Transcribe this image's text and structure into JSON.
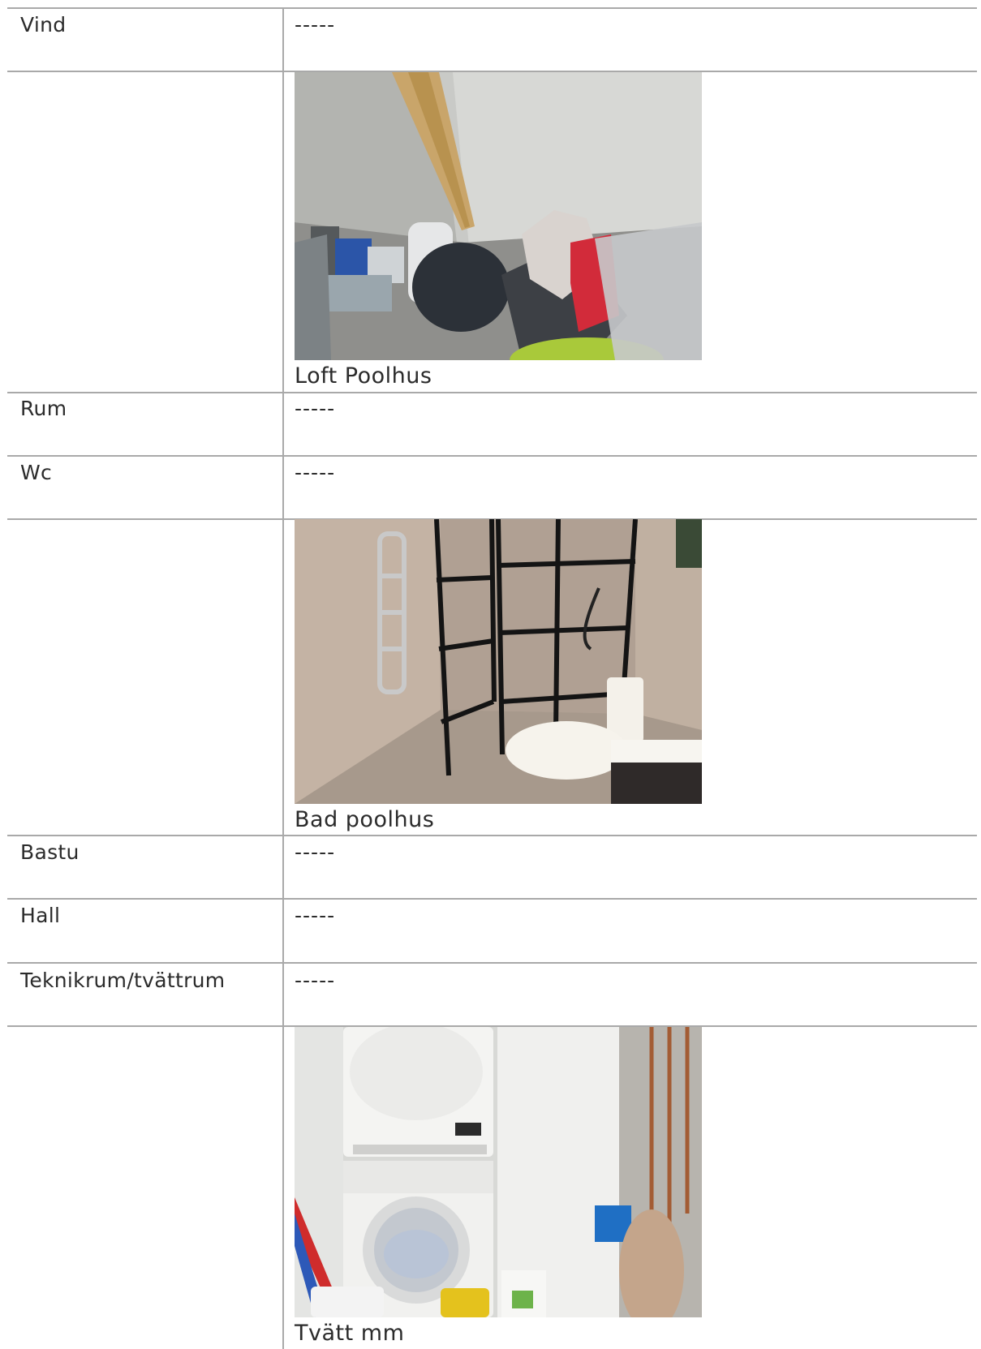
{
  "rows": [
    {
      "label": "Vind",
      "value": "-----"
    },
    {
      "caption": "Loft Poolhus",
      "image": "attic-storage-photo"
    },
    {
      "label": "Rum",
      "value": "-----"
    },
    {
      "label": "Wc",
      "value": "-----"
    },
    {
      "caption": "Bad poolhus",
      "image": "bathroom-photo"
    },
    {
      "label": "Bastu",
      "value": "-----"
    },
    {
      "label": "Hall",
      "value": "-----"
    },
    {
      "label": "Teknikrum/tvättrum",
      "value": "-----"
    },
    {
      "caption": "Tvätt mm",
      "image": "laundry-room-photo"
    }
  ]
}
